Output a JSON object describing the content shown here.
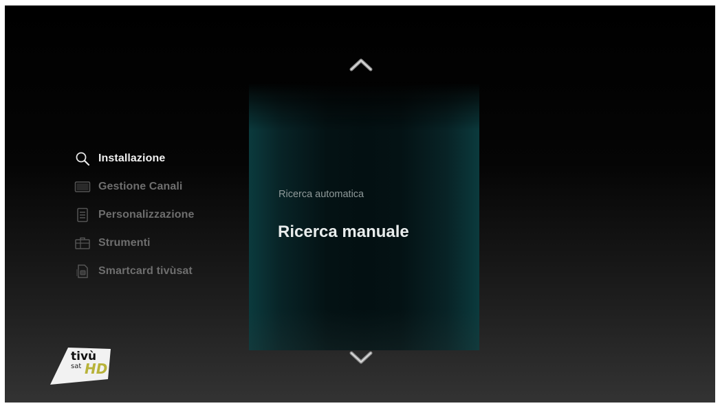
{
  "menu": {
    "items": [
      {
        "label": "Installazione",
        "icon": "search-icon",
        "selected": true
      },
      {
        "label": "Gestione Canali",
        "icon": "tv-icon",
        "selected": false
      },
      {
        "label": "Personalizzazione",
        "icon": "settings-panel-icon",
        "selected": false
      },
      {
        "label": "Strumenti",
        "icon": "toolbox-icon",
        "selected": false
      },
      {
        "label": "Smartcard tivùsat",
        "icon": "smartcard-icon",
        "selected": false
      }
    ]
  },
  "submenu": {
    "options": [
      {
        "label": "Ricerca automatica",
        "focused": false
      },
      {
        "label": "Ricerca manuale",
        "focused": true
      }
    ],
    "scroll_up_icon": "chevron-up-icon",
    "scroll_down_icon": "chevron-down-icon"
  },
  "logo": {
    "brand": "tivù",
    "sub": "sat",
    "badge": "HD"
  },
  "colors": {
    "panel_accent": "#0b3a3d",
    "menu_active": "#f0f0f0",
    "menu_inactive": "#6e6e6e",
    "hd_badge": "#b8b33a"
  }
}
